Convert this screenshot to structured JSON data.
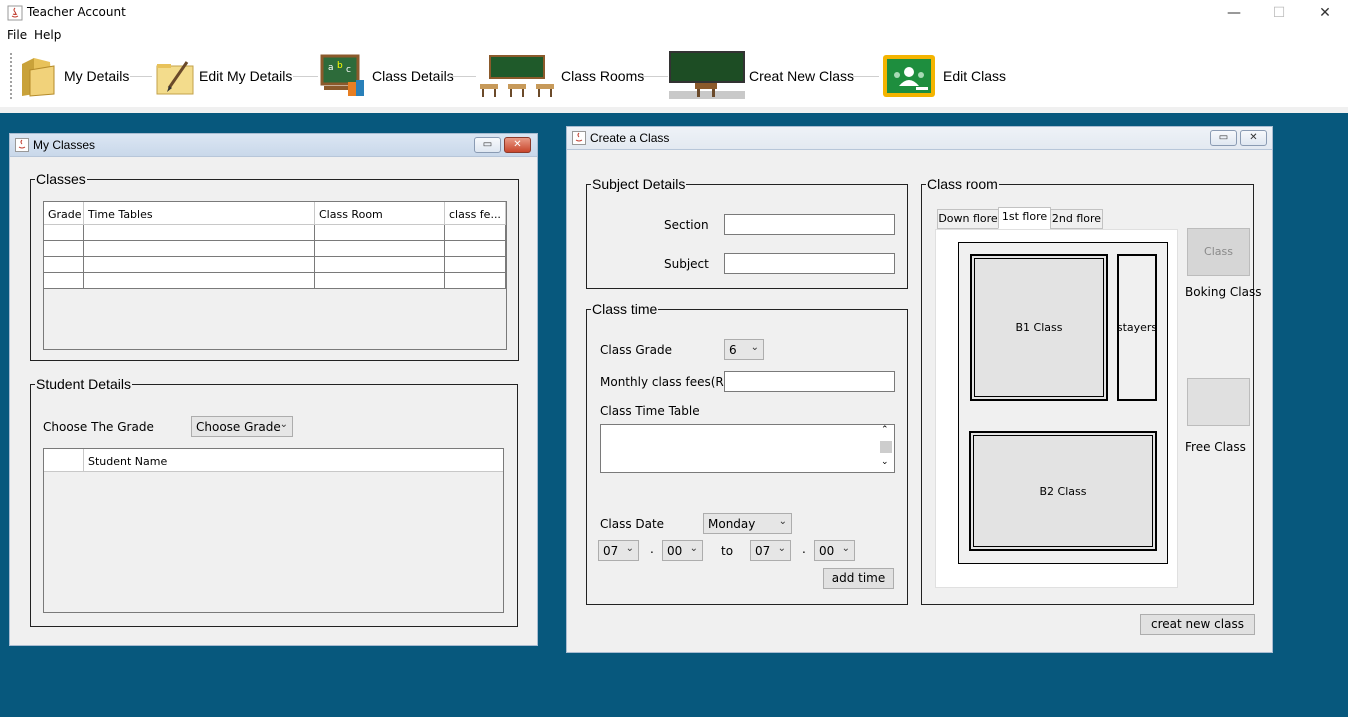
{
  "window": {
    "title": "Teacher Account",
    "minimize": "—",
    "maximize": "☐",
    "close": "✕"
  },
  "menu": {
    "file": "File",
    "help": "Help"
  },
  "toolbar": {
    "my_details": "My Details",
    "edit_my_details": "Edit My Details",
    "class_details": "Class Details",
    "class_rooms": "Class Rooms",
    "creat_new_class": "Creat New Class",
    "edit_class": "Edit Class"
  },
  "my_classes": {
    "title": "My Classes",
    "classes_group": "Classes",
    "columns": [
      "Grade",
      "Time Tables",
      "Class Room",
      "class fe..."
    ],
    "student_group": "Student Details",
    "choose_grade_label": "Choose The Grade",
    "choose_grade_value": "Choose Grade",
    "student_columns": [
      "",
      "Student Name"
    ]
  },
  "create_class": {
    "title": "Create a Class",
    "subject_group": "Subject Details",
    "section_label": "Section",
    "subject_label": "Subject",
    "time_group": "Class time",
    "grade_label": "Class Grade",
    "grade_value": "6",
    "fees_label": "Monthly class fees(Rs)",
    "timetable_label": "Class Time Table",
    "date_label": "Class Date",
    "date_value": "Monday",
    "from_hour": "07",
    "from_min": "00",
    "to_label": "to",
    "to_hour": "07",
    "to_min": "00",
    "dot": ".",
    "add_time": "add time",
    "room_group": "Class room",
    "tabs": [
      "Down flore",
      "1st flore",
      "2nd flore"
    ],
    "b1": "B1 Class",
    "stairs": "stayers",
    "b2": "B2 Class",
    "legend_booking_swatch": "Class",
    "legend_booking": "Boking Class",
    "legend_free": "Free Class",
    "creat_button": "creat new class"
  }
}
